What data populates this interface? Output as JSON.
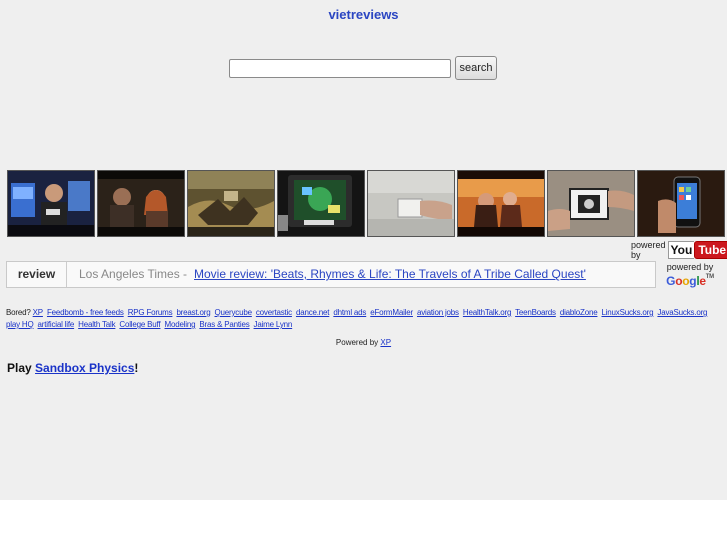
{
  "site": {
    "title": "vietreviews"
  },
  "search": {
    "value": "",
    "placeholder": "",
    "button_label": "search"
  },
  "thumbnails": [
    {
      "name": "video-thumbnail-1",
      "icon": "man-with-monitors"
    },
    {
      "name": "video-thumbnail-2",
      "icon": "couple-scene"
    },
    {
      "name": "video-thumbnail-3",
      "icon": "desert-battle"
    },
    {
      "name": "video-thumbnail-4",
      "icon": "tablet-game"
    },
    {
      "name": "video-thumbnail-5",
      "icon": "hand-device"
    },
    {
      "name": "video-thumbnail-6",
      "icon": "titanic-sunset"
    },
    {
      "name": "video-thumbnail-7",
      "icon": "unboxing-device"
    },
    {
      "name": "video-thumbnail-8",
      "icon": "smartphone-hand"
    }
  ],
  "youtube": {
    "powered_label": "powered by",
    "logo_you": "You",
    "logo_tube": "Tube"
  },
  "news": {
    "label": "review",
    "source": "Los Angeles Times -",
    "headline": "Movie review: 'Beats, Rhymes & Life: The Travels of A Tribe Called Quest'"
  },
  "google": {
    "powered_label": "powered by",
    "logo": [
      "G",
      "o",
      "o",
      "g",
      "l",
      "e"
    ],
    "tm": "TM"
  },
  "links": {
    "prefix": "Bored?",
    "items": [
      "XP",
      "Feedbomb - free feeds",
      "RPG Forums",
      "breast.org",
      "Querycube",
      "covertastic",
      "dance.net",
      "dhtml ads",
      "eFormMailer",
      "aviation jobs",
      "HealthTalk.org",
      "TeenBoards",
      "diabloZone",
      "LinuxSucks.org",
      "JavaSucks.org",
      "play HQ",
      "artificial life",
      "Health Talk",
      "College Buff",
      "Modeling",
      "Bras & Panties",
      "Jaime Lynn"
    ]
  },
  "footer": {
    "powered_text": "Powered by",
    "powered_link": "XP"
  },
  "play": {
    "prefix": "Play",
    "link": "Sandbox Physics",
    "suffix": "!"
  },
  "colors": {
    "link": "#1a33c8",
    "title": "#2a45c2",
    "background": "#efefef",
    "youtube_red": "#cc181e"
  }
}
